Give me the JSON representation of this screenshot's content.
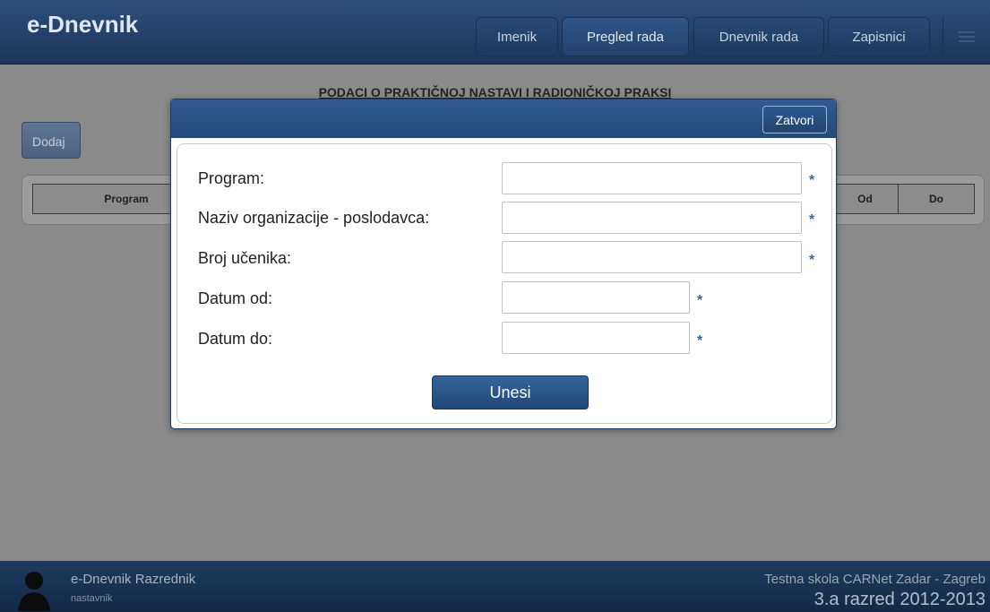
{
  "app": {
    "title": "e-Dnevnik"
  },
  "nav": [
    {
      "label": "Imenik"
    },
    {
      "label": "Pregled rada"
    },
    {
      "label": "Dnevnik rada"
    },
    {
      "label": "Zapisnici"
    }
  ],
  "page": {
    "title": "PODACI O PRAKTIČNOJ NASTAVI I RADIONIČKOJ PRAKSI",
    "add_label": "Dodaj",
    "columns": [
      "Program",
      "Od",
      "Do"
    ]
  },
  "modal": {
    "close_label": "Zatvori",
    "fields": [
      {
        "label": "Program:",
        "value": "",
        "required_mark": "*"
      },
      {
        "label": "Naziv organizacije - poslodavca:",
        "value": "",
        "required_mark": "*"
      },
      {
        "label": "Broj učenika:",
        "value": "",
        "required_mark": "*"
      },
      {
        "label": "Datum od:",
        "value": "",
        "required_mark": "*"
      },
      {
        "label": "Datum do:",
        "value": "",
        "required_mark": "*"
      }
    ],
    "submit_label": "Unesi"
  },
  "footer": {
    "user_name": "e-Dnevnik Razrednik",
    "user_role": "nastavnik",
    "school": "Testna skola CARNet Zadar - Zagreb",
    "class_year": "3.a razred 2012-2013"
  },
  "colors": {
    "brand": "#1c3557",
    "accent": "#2f5b92",
    "required": "#2f6aa8"
  }
}
